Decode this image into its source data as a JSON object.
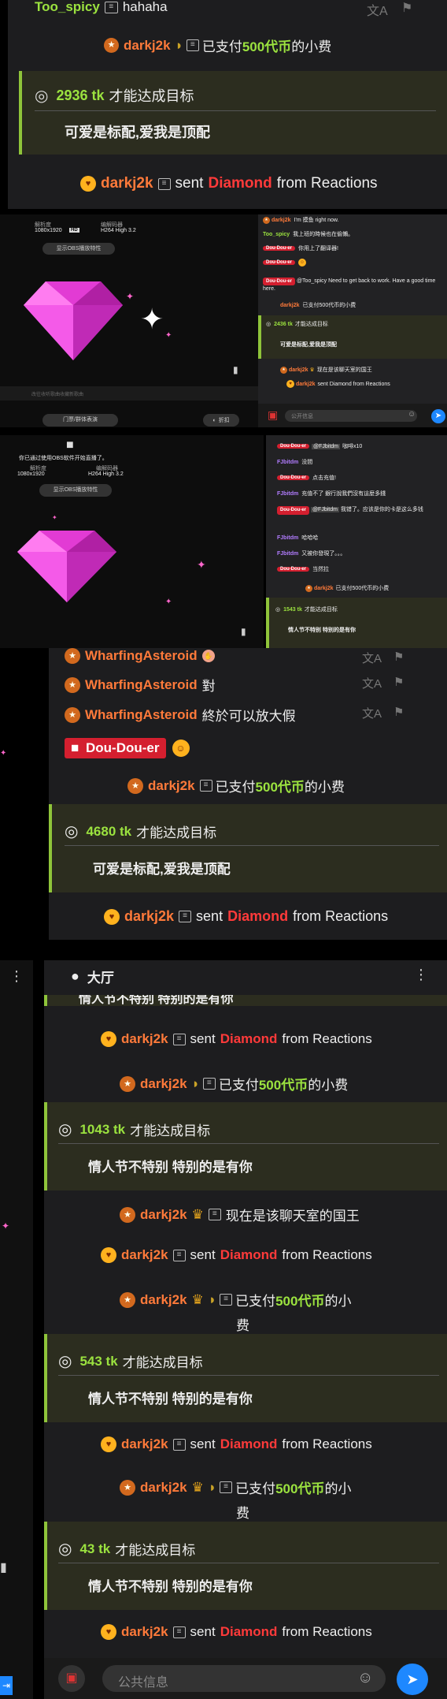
{
  "s1": {
    "top_name": "Too_spicy",
    "top_msg": "hahaha",
    "pay_name": "darkj2k",
    "pay_pre": "已支付",
    "pay_amount": "500代币",
    "pay_post": "的小费",
    "goal_tk": "2936 tk",
    "goal_label": "才能达成目标",
    "goal_msg": "可爱是标配,爱我是顶配",
    "gift_name": "darkj2k",
    "gift_sent": "sent",
    "gift_item": "Diamond",
    "gift_from": "from Reactions"
  },
  "s2": {
    "res_label": "解析度",
    "res_val": "1080x1920",
    "hd": "HD",
    "codec_label": "编解码器",
    "codec_val": "H264 High 3.2",
    "obs_btn": "显示OBS播放特性",
    "bar_text": "改往收听歌曲收藏新歌曲",
    "btn_left": "门票/群体表演",
    "btn_right": "折扣",
    "chat": [
      {
        "name": "darkj2k",
        "text": "I'm 摸鱼 right now."
      },
      {
        "name": "Too_spicy",
        "text": "我上班的時候也在偷懶。"
      },
      {
        "name": "Dou-Dou-er",
        "text": "你用上了翻译器!"
      },
      {
        "name": "Dou-Dou-er",
        "text": ""
      },
      {
        "name": "Dou-Dou-er",
        "text": "@Too_spicy  Need to get back to work. Have a good time here."
      },
      {
        "name": "darkj2k",
        "text": "已支付500代币的小费"
      }
    ],
    "goal_tk": "2436 tk",
    "goal_label": "才能达成目标",
    "goal_msg": "可爱是标配,爱我是顶配",
    "king_name": "darkj2k",
    "king_msg": "现在是该聊天室的国王",
    "gift_name": "darkj2k",
    "gift_text": "sent Diamond from Reactions",
    "input_placeholder": "公开信息"
  },
  "s3": {
    "top_text": "你已通过使用OBS软件开始直播了。",
    "res_label": "解析度",
    "res_val": "1080x1920",
    "codec_label": "编解码器",
    "codec_val": "H264 High 3.2",
    "obs_btn": "显示OBS播放特性",
    "chat": [
      {
        "name": "Dou-Dou-er",
        "mention": "@FJbitdm",
        "text": "咖啡x10"
      },
      {
        "name": "FJbitdm",
        "text": "没間"
      },
      {
        "name": "Dou-Dou-er",
        "text": "点击充值!"
      },
      {
        "name": "FJbitdm",
        "text": "充值不了 銀行說我們沒有這麼多錢"
      },
      {
        "name": "Dou-Dou-er",
        "mention": "@FJbitdm",
        "text": "我错了。应该是你的卡是这么多钱"
      },
      {
        "name": "FJbitdm",
        "text": "哈哈哈"
      },
      {
        "name": "FJbitdm",
        "text": "又被你發現了。。。"
      },
      {
        "name": "Dou-Dou-er",
        "text": "当然拉"
      },
      {
        "name": "darkj2k",
        "text": "已支付500代币的小费"
      }
    ],
    "goal_tk": "1543 tk",
    "goal_label": "才能达成目标",
    "goal_msg": "情人节不特别 特别的是有你"
  },
  "s4": {
    "rows": [
      {
        "name": "WharfingAsteroid",
        "text": ""
      },
      {
        "name": "WharfingAsteroid",
        "text": "對"
      },
      {
        "name": "WharfingAsteroid",
        "text": "終於可以放大假"
      }
    ],
    "dd_name": "Dou-Dou-er",
    "pay_name": "darkj2k",
    "pay_pre": "已支付",
    "pay_amount": "500代币",
    "pay_post": "的小费",
    "goal_tk": "4680 tk",
    "goal_label": "才能达成目标",
    "goal_msg": "可爱是标配,爱我是顶配",
    "gift_name": "darkj2k",
    "gift_sent": "sent",
    "gift_item": "Diamond",
    "gift_from": "from Reactions"
  },
  "s5": {
    "header": "大厅",
    "cut_text": "情人节不特别 特别的是有你",
    "gift1_name": "darkj2k",
    "pay1_name": "darkj2k",
    "goal1_tk": "1043 tk",
    "goal1_label": "才能达成目标",
    "goal1_msg": "情人节不特别 特别的是有你",
    "king_name": "darkj2k",
    "king_msg": "现在是该聊天室的国王",
    "gift2_name": "darkj2k",
    "pay2_name": "darkj2k",
    "pay2_pre": "已支付",
    "pay2_amount": "500代币",
    "pay2_post": "的小",
    "pay2_post2": "费",
    "goal2_tk": "543 tk",
    "goal2_label": "才能达成目标",
    "goal2_msg": "情人节不特别 特别的是有你",
    "gift3_name": "darkj2k",
    "pay3_name": "darkj2k",
    "pay3_pre": "已支付",
    "pay3_amount": "500代币",
    "pay3_post": "的小",
    "pay3_post2": "费",
    "goal3_tk": "43 tk",
    "goal3_label": "才能达成目标",
    "goal3_msg": "情人节不特别 特别的是有你",
    "gift4_name": "darkj2k",
    "gift_sent": "sent",
    "gift_item": "Diamond",
    "gift_from": "from Reactions",
    "pay_pre": "已支付",
    "pay_amount": "500代币",
    "pay_post": "的小费",
    "input_placeholder": "公共信息"
  },
  "colors": {
    "accent": "#9be23f",
    "diamond": "#ff3a3a",
    "send": "#1e88ff"
  }
}
